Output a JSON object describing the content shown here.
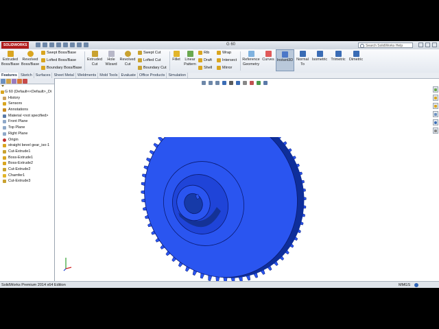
{
  "app": {
    "logo_text": "SOLIDWORKS",
    "document_title": "G 60",
    "search_placeholder": "Search SolidWorks Help"
  },
  "ribbon": {
    "extruded_boss": "Extruded Boss/Base",
    "revolved_boss": "Revolved Boss/Base",
    "swept_boss": "Swept Boss/Base",
    "lofted_boss": "Lofted Boss/Base",
    "boundary_boss": "Boundary Boss/Base",
    "extruded_cut": "Extruded Cut",
    "hole_wizard": "Hole Wizard",
    "revolved_cut": "Revolved Cut",
    "swept_cut": "Swept Cut",
    "lofted_cut": "Lofted Cut",
    "boundary_cut": "Boundary Cut",
    "fillet": "Fillet",
    "linear_pattern": "Linear Pattern",
    "rib": "Rib",
    "draft": "Draft",
    "shell": "Shell",
    "wrap": "Wrap",
    "intersect": "Intersect",
    "mirror": "Mirror",
    "reference_geometry": "Reference Geometry",
    "curves": "Curves",
    "instant3d": "Instant3D",
    "normal_to": "Normal To",
    "isometric": "Isometric",
    "trimetric": "Trimetric",
    "dimetric": "Dimetric"
  },
  "command_tabs": [
    "Features",
    "Sketch",
    "Surfaces",
    "Sheet Metal",
    "Weldments",
    "Mold Tools",
    "Evaluate",
    "Office Products",
    "Simulation"
  ],
  "feature_tree": {
    "root": "G 60  (Default<<Default>_Di",
    "items": [
      "History",
      "Sensors",
      "Annotations",
      "Material <not specified>",
      "Front Plane",
      "Top Plane",
      "Right Plane",
      "Origin",
      "straight bevel gear_iso-1",
      "Cut-Extrude1",
      "Boss-Extrude1",
      "Boss-Extrude2",
      "Cut-Extrude2",
      "Chamfer1",
      "Cut-Extrude3"
    ]
  },
  "status_bar": {
    "edition": "SolidWorks Premium 2014 x64 Edition",
    "units": "MMGS"
  },
  "colors": {
    "model_blue": "#2a55f0",
    "model_edge": "#0a1a70"
  }
}
